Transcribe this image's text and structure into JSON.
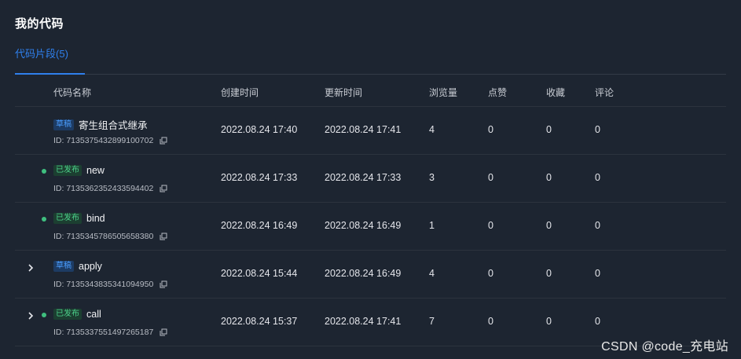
{
  "page_title": "我的代码",
  "tab": {
    "label": "代码片段",
    "count": "(5)"
  },
  "columns": {
    "name": "代码名称",
    "created": "创建时间",
    "updated": "更新时间",
    "views": "浏览量",
    "likes": "点赞",
    "favorites": "收藏",
    "comments": "评论"
  },
  "rows": [
    {
      "badge": "草稿",
      "status": "draft",
      "has_dot": false,
      "expandable": false,
      "name": "寄生组合式继承",
      "id": "ID: 7135375432899100702",
      "created": "2022.08.24 17:40",
      "updated": "2022.08.24 17:41",
      "views": "4",
      "likes": "0",
      "favorites": "0",
      "comments": "0"
    },
    {
      "badge": "已发布",
      "status": "published",
      "has_dot": true,
      "expandable": false,
      "name": "new",
      "id": "ID: 7135362352433594402",
      "created": "2022.08.24 17:33",
      "updated": "2022.08.24 17:33",
      "views": "3",
      "likes": "0",
      "favorites": "0",
      "comments": "0"
    },
    {
      "badge": "已发布",
      "status": "published",
      "has_dot": true,
      "expandable": false,
      "name": "bind",
      "id": "ID: 7135345786505658380",
      "created": "2022.08.24 16:49",
      "updated": "2022.08.24 16:49",
      "views": "1",
      "likes": "0",
      "favorites": "0",
      "comments": "0"
    },
    {
      "badge": "草稿",
      "status": "draft",
      "has_dot": false,
      "expandable": true,
      "name": "apply",
      "id": "ID: 7135343835341094950",
      "created": "2022.08.24 15:44",
      "updated": "2022.08.24 16:49",
      "views": "4",
      "likes": "0",
      "favorites": "0",
      "comments": "0"
    },
    {
      "badge": "已发布",
      "status": "published",
      "has_dot": true,
      "expandable": true,
      "name": "call",
      "id": "ID: 7135337551497265187",
      "created": "2022.08.24 15:37",
      "updated": "2022.08.24 17:41",
      "views": "7",
      "likes": "0",
      "favorites": "0",
      "comments": "0"
    }
  ],
  "watermark": "CSDN @code_充电站",
  "colors": {
    "background": "#1d2531",
    "accent": "#2f80ed",
    "draft_badge": "#4a9eff",
    "published_badge": "#4cd08a",
    "status_dot": "#3fbf7f"
  },
  "icons": {
    "expand": "chevron-right-icon",
    "copy": "copy-icon",
    "status": "status-dot-icon"
  }
}
